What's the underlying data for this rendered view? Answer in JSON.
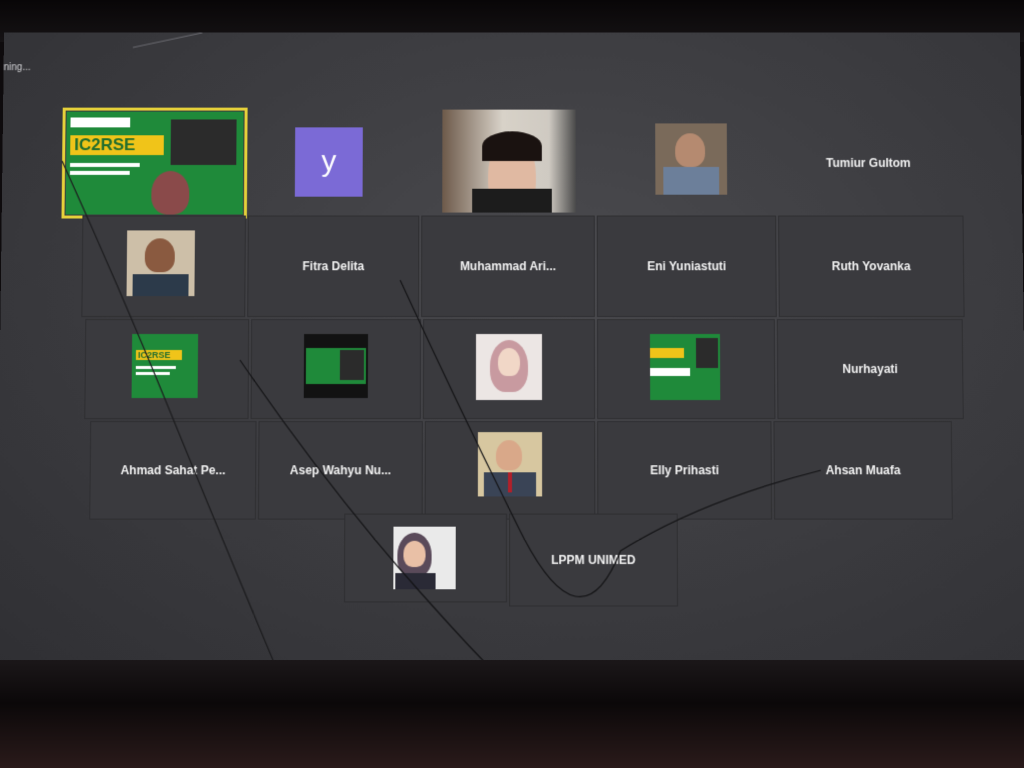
{
  "status": {
    "text": "ning..."
  },
  "active_speaker": {
    "slide_title": "IC2RSE"
  },
  "participants": {
    "fitra": "Fitra Delita",
    "muhammad": "Muhammad Ari...",
    "eni": "Eni Yuniastuti",
    "ruth": "Ruth Yovanka",
    "tumiur": "Tumiur Gultom",
    "nurhayati": "Nurhayati",
    "ahmad": "Ahmad Sahat Pe...",
    "asep": "Asep Wahyu Nu...",
    "elly": "Elly Prihasti",
    "ahsan": "Ahsan Muafa",
    "lppm": "LPPM UNIMED"
  },
  "avatar_letter": "y",
  "colors": {
    "active_border": "#e6d13a",
    "avatar_purple": "#7b6ad6",
    "slide_green": "#1f8a3a",
    "slide_yellow": "#f0c419"
  }
}
